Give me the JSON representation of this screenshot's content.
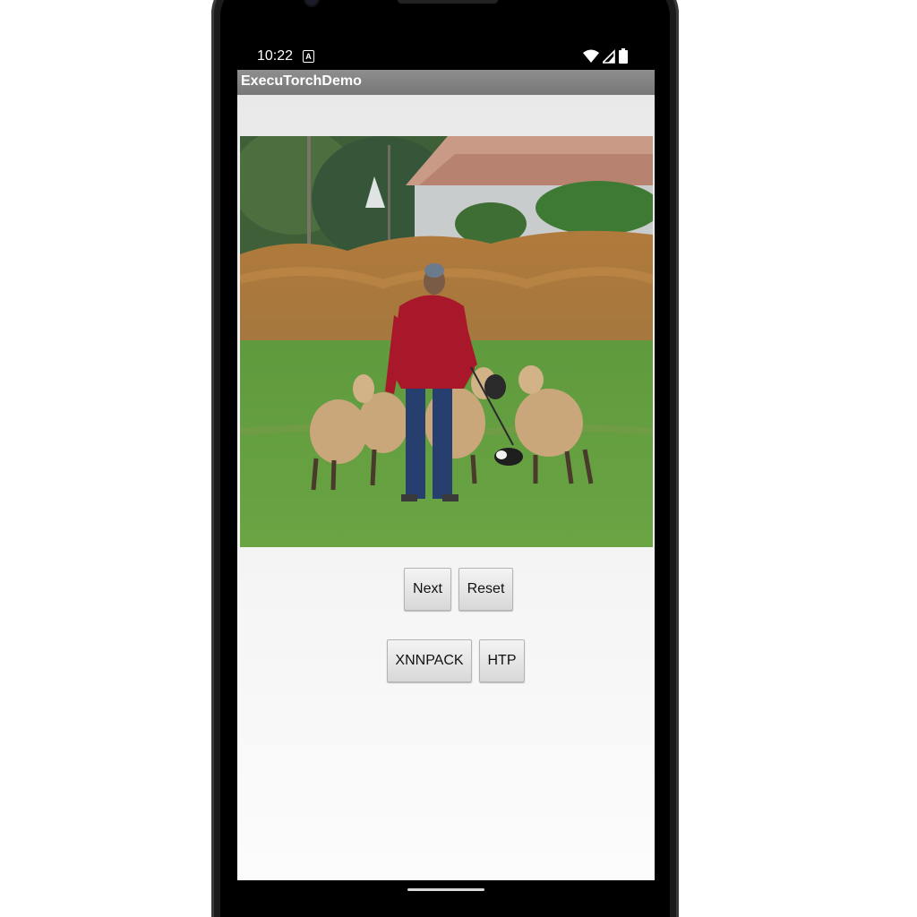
{
  "status_bar": {
    "time": "10:22",
    "notification_icon": "a-icon",
    "icons": [
      "wifi-icon",
      "signal-icon",
      "battery-icon"
    ]
  },
  "app_bar": {
    "title": "ExecuTorchDemo"
  },
  "image": {
    "subject": "sheep-herding-photo"
  },
  "buttons": {
    "next_label": "Next",
    "reset_label": "Reset",
    "xnnpack_label": "XNNPACK",
    "htp_label": "HTP"
  },
  "colors": {
    "app_bar": "#858585",
    "content_bg": "#efefef",
    "button_bg": "#e4e4e4"
  }
}
